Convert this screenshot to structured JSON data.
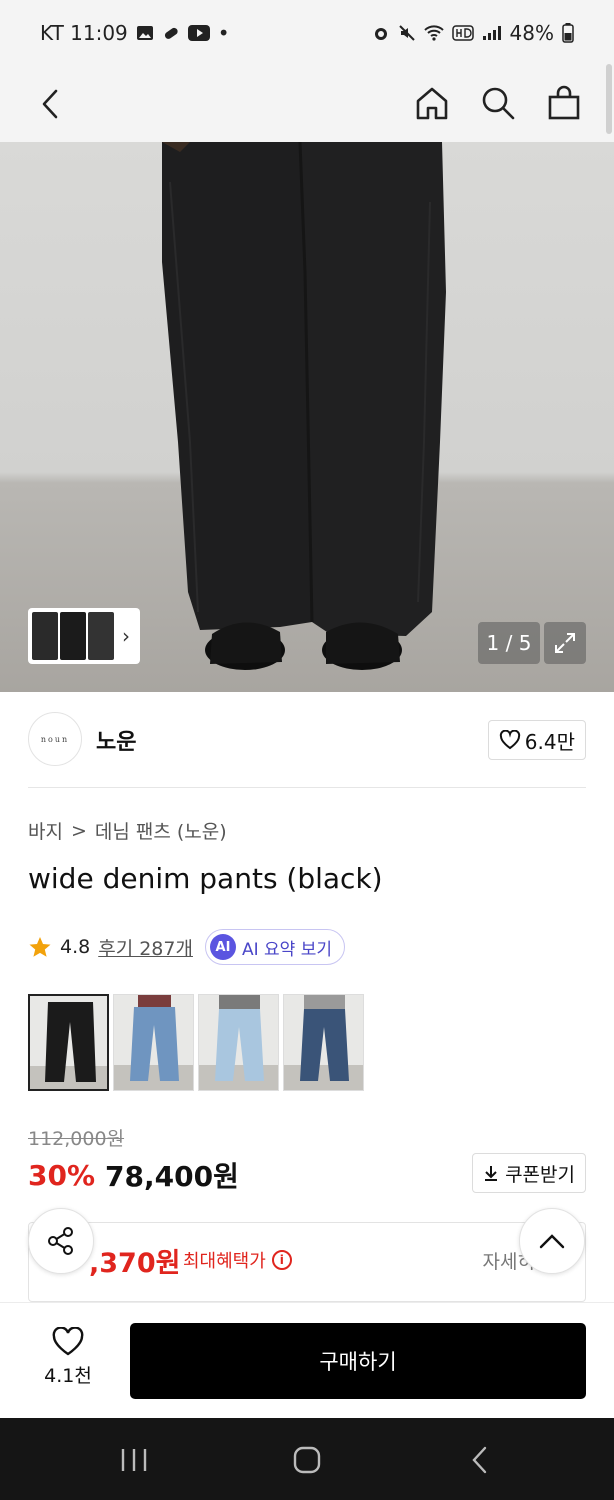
{
  "status_bar": {
    "carrier_time": "KT 11:09",
    "dot": "•",
    "battery": "48%"
  },
  "hero": {
    "pager": "1 / 5"
  },
  "brand": {
    "logo_text": "noun",
    "name": "노운",
    "likes": "6.4만"
  },
  "breadcrumb": {
    "category": "바지",
    "separator": ">",
    "subcategory": "데님 팬츠 (노운)"
  },
  "product": {
    "title": "wide denim pants (black)",
    "rating": "4.8",
    "reviews": "후기 287개",
    "ai_badge": "AI",
    "ai_summary": "AI 요약 보기"
  },
  "color_swatches": [
    {
      "name": "black",
      "selected": true
    },
    {
      "name": "light-blue-1",
      "selected": false
    },
    {
      "name": "light-blue-2",
      "selected": false
    },
    {
      "name": "dark-blue",
      "selected": false
    }
  ],
  "price": {
    "original": "112,000원",
    "discount": "30%",
    "final": "78,400원",
    "coupon_label": "쿠폰받기"
  },
  "benefit": {
    "price": ",370원",
    "label": "최대혜택가",
    "info_icon_text": "i",
    "detail": "자세히"
  },
  "bottom": {
    "wish_count": "4.1천",
    "buy_label": "구매하기"
  },
  "colors": {
    "accent_red": "#e0251e",
    "ai_purple": "#5b55e0",
    "buy_black": "#000000"
  }
}
